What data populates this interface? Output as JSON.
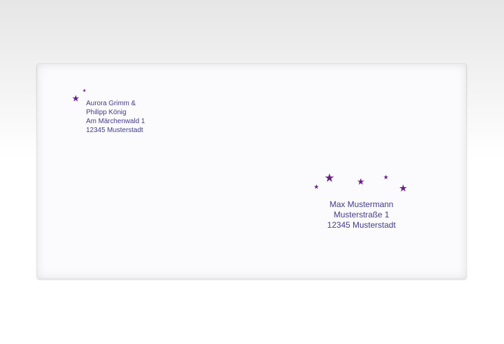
{
  "colors": {
    "text": "#433a86",
    "star": "#6c1f86"
  },
  "sender": {
    "lines": [
      "Aurora Grimm &",
      "Philipp König",
      "Am Märchenwald 1",
      "12345 Musterstadt"
    ]
  },
  "recipient": {
    "lines": [
      "Max Mustermann",
      "Musterstraße 1",
      "12345 Musterstadt"
    ]
  },
  "decoration": {
    "icon": "star-icon"
  }
}
